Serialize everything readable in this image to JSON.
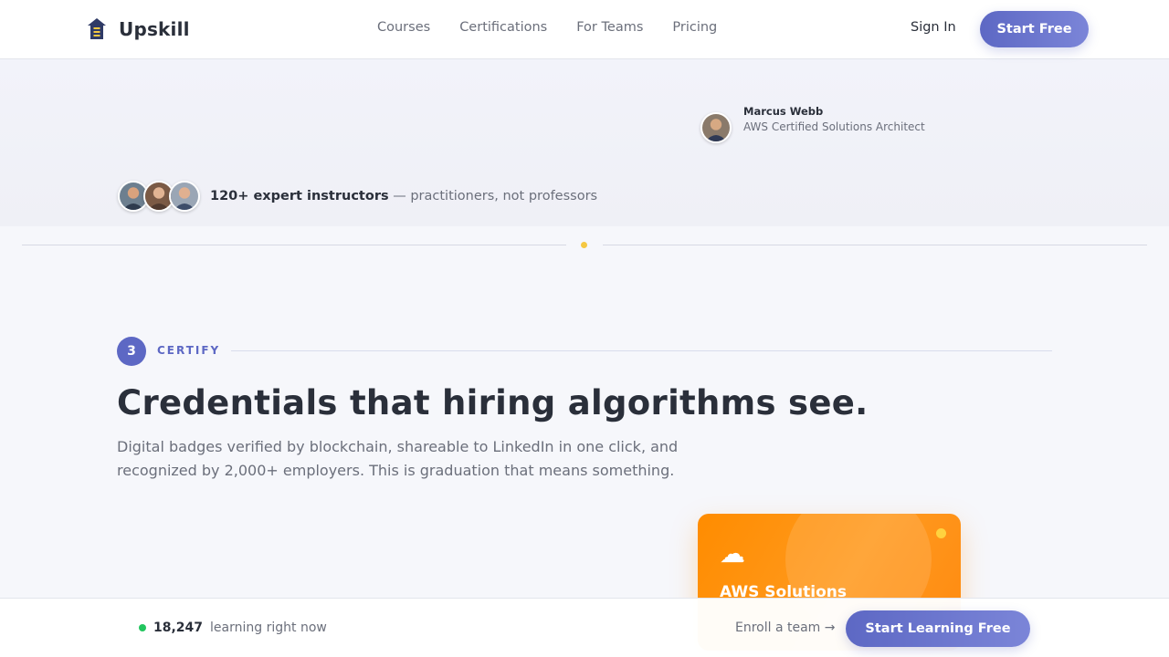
{
  "nav": {
    "brand": "Upskill",
    "links": [
      "Courses",
      "Certifications",
      "For Teams",
      "Pricing"
    ],
    "sign_in": "Sign In",
    "cta": "Start Free"
  },
  "hero": {
    "testimonial": {
      "name": "Marcus Webb",
      "role": "AWS Certified Solutions Architect"
    },
    "instructors": {
      "highlight": "120+ expert instructors",
      "rest": " — practitioners, not professors"
    }
  },
  "certify": {
    "step_number": "3",
    "step_label": "CERTIFY",
    "headline": "Credentials that hiring algorithms see.",
    "subcopy": "Digital badges verified by blockchain, shareable to LinkedIn in one click, and recognized by 2,000+ employers. This is graduation that means something.",
    "badge": {
      "icon": "☁",
      "title": "AWS Solutions"
    }
  },
  "bottom_bar": {
    "live_count": "18,247",
    "live_text": "learning right now",
    "enroll_link": "Enroll a team →",
    "cta": "Start Learning Free"
  },
  "colors": {
    "accent": "#5d68c4",
    "badge_orange": "#ff8c00",
    "live_green": "#22c55e",
    "divider_dot": "#f5c842"
  },
  "icons": [
    "brand-logo-icon",
    "cloud-icon",
    "live-status-dot"
  ]
}
